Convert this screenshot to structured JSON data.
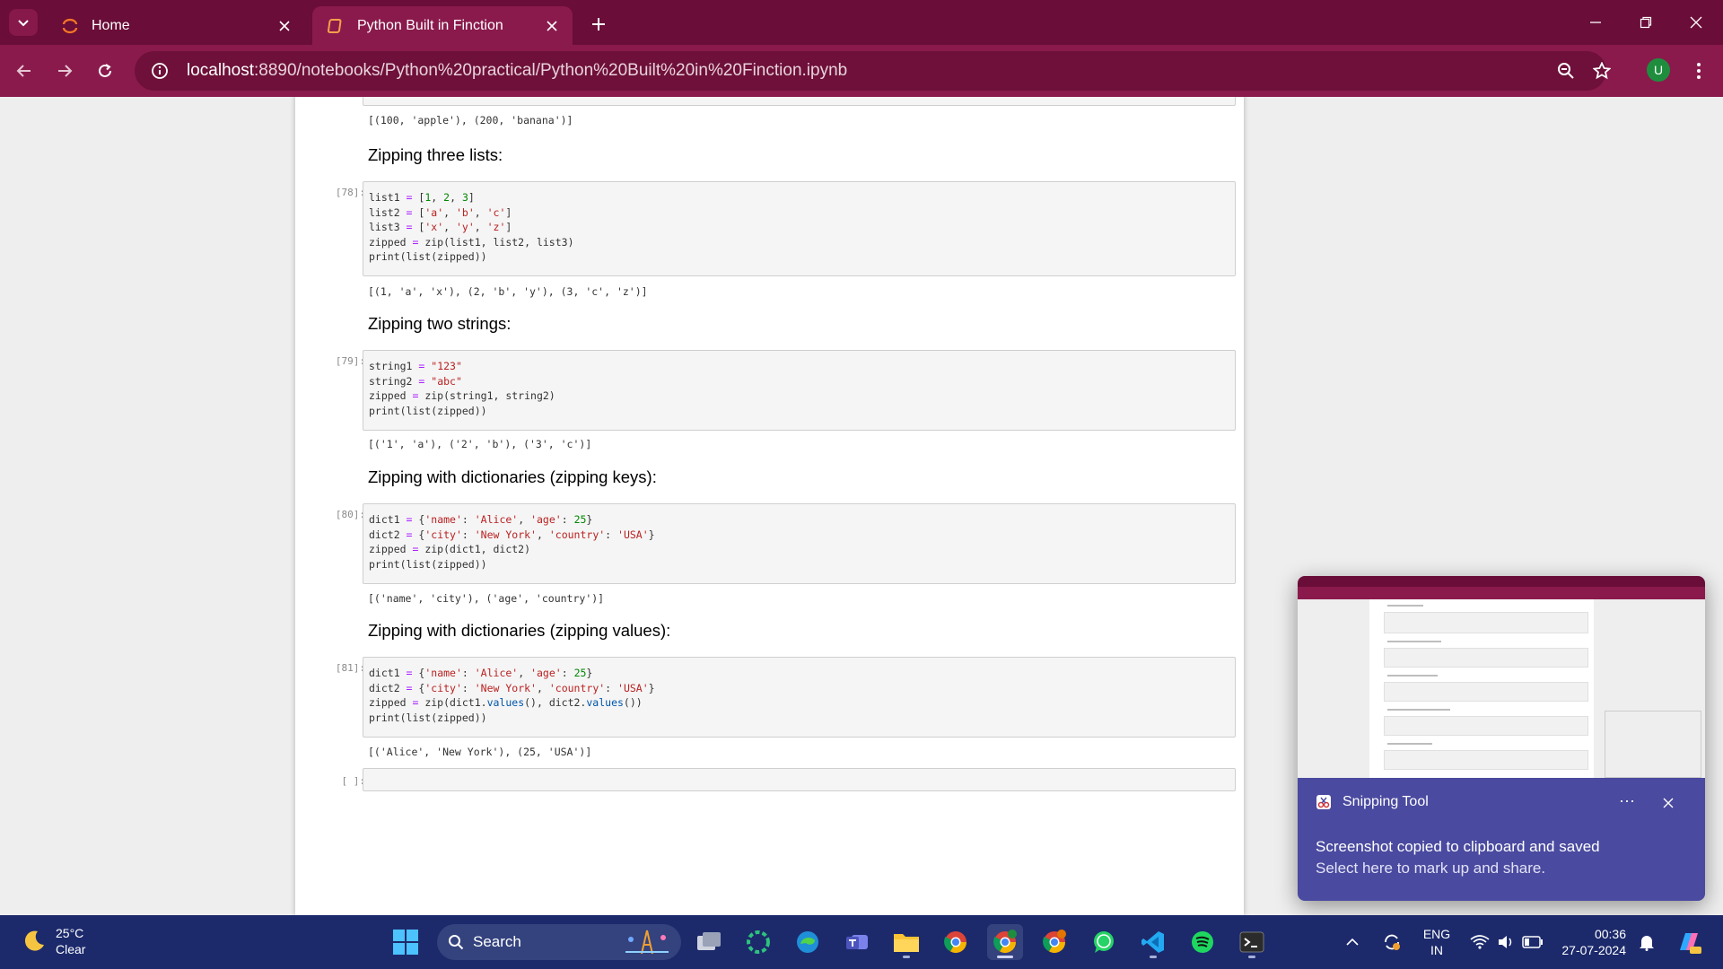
{
  "browser": {
    "tabs": [
      {
        "title": "Home"
      },
      {
        "title": "Python Built in Finction"
      }
    ],
    "url_host": "localhost",
    "url_rest": ":8890/notebooks/Python%20practical/Python%20Built%20in%20Finction.ipynb",
    "profile_initial": "U"
  },
  "notebook": {
    "top_output": "[(100, 'apple'), (200, 'banana')]",
    "sections": [
      {
        "heading": "Zipping three lists:",
        "prompt": "[78]:",
        "output": "[(1, 'a', 'x'), (2, 'b', 'y'), (3, 'c', 'z')]"
      },
      {
        "heading": "Zipping two strings:",
        "prompt": "[79]:",
        "output": "[('1', 'a'), ('2', 'b'), ('3', 'c')]"
      },
      {
        "heading": "Zipping with dictionaries (zipping keys):",
        "prompt": "[80]:",
        "output": "[('name', 'city'), ('age', 'country')]"
      },
      {
        "heading": "Zipping with dictionaries (zipping values):",
        "prompt": "[81]:",
        "output": "[('Alice', 'New York'), (25, 'USA')]"
      }
    ],
    "empty_prompt": "[ ]:"
  },
  "toast": {
    "app": "Snipping Tool",
    "more": "···",
    "title": "Screenshot copied to clipboard and saved",
    "subtitle": "Select here to mark up and share."
  },
  "taskbar": {
    "temperature": "25°C",
    "condition": "Clear",
    "search_label": "Search",
    "lang_top": "ENG",
    "lang_bottom": "IN",
    "time": "00:36",
    "date": "27-07-2024"
  },
  "colors": {
    "tabbar": "#6a0d38",
    "toolbar": "#8a1a4c",
    "taskbar": "#1c2a6c",
    "toast": "#4a4aa0"
  }
}
